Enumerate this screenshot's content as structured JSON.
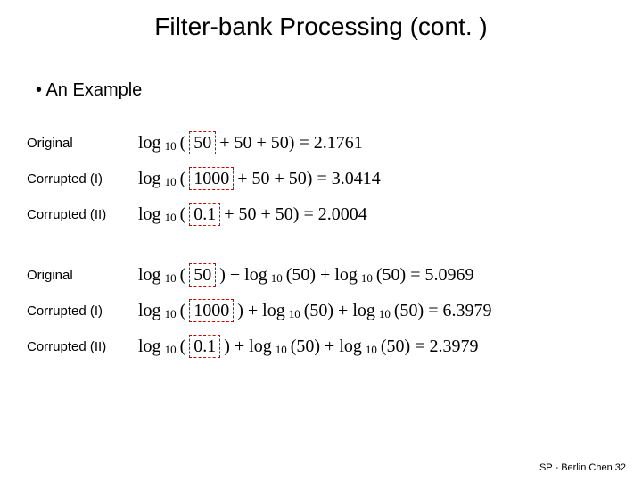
{
  "title": "Filter-bank Processing (cont. )",
  "bullet": "•   An Example",
  "group1": {
    "rows": [
      {
        "label": "Original",
        "pre": "log",
        "sub": "10",
        "open": "(",
        "boxed": "50",
        "post": " + 50 + 50) = 2.1761"
      },
      {
        "label": "Corrupted (I)",
        "pre": "log",
        "sub": "10",
        "open": "(",
        "boxed": "1000",
        "post": " + 50 + 50) = 3.0414"
      },
      {
        "label": "Corrupted (II)",
        "pre": "log",
        "sub": "10",
        "open": "(",
        "boxed": "0.1",
        "post": " + 50 + 50) = 2.0004"
      }
    ]
  },
  "group2": {
    "rows": [
      {
        "label": "Original",
        "pre": "log",
        "sub": "10",
        "open": "(",
        "boxed": "50",
        "mid1": ") + log",
        "sub2": "10",
        "mid2": "(50) + log",
        "sub3": "10",
        "post": "(50) = 5.0969"
      },
      {
        "label": "Corrupted (I)",
        "pre": "log",
        "sub": "10",
        "open": "(",
        "boxed": "1000",
        "mid1": ") + log",
        "sub2": "10",
        "mid2": "(50) + log",
        "sub3": "10",
        "post": "(50) = 6.3979"
      },
      {
        "label": "Corrupted (II)",
        "pre": "log",
        "sub": "10",
        "open": "(",
        "boxed": "0.1",
        "mid1": ") + log",
        "sub2": "10",
        "mid2": "(50) + log",
        "sub3": "10",
        "post": "(50) = 2.3979"
      }
    ]
  },
  "footer": "SP - Berlin Chen   32"
}
